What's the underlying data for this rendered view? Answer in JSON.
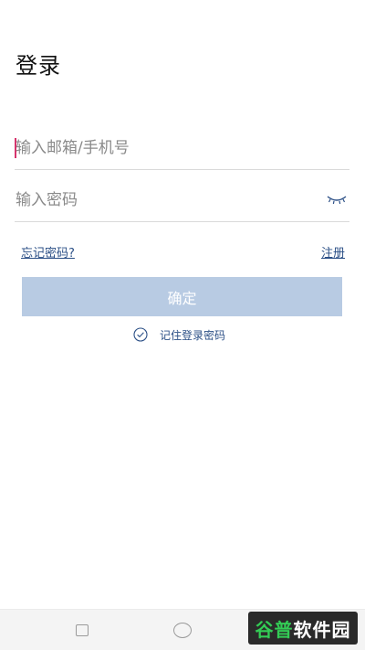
{
  "header": {
    "title": "登录"
  },
  "form": {
    "account_placeholder": "输入邮箱/手机号",
    "password_placeholder": "输入密码",
    "forgot_label": "忘记密码?",
    "register_label": "注册",
    "confirm_label": "确定",
    "remember_label": "记住登录密码"
  },
  "watermark": {
    "part1": "谷普",
    "part2": "软件园"
  },
  "colors": {
    "accent": "#2b4f86",
    "button_disabled": "#b8cbe3",
    "caret": "#d6336c"
  },
  "icons": [
    "eye-closed-icon",
    "check-circle-icon",
    "nav-recent-icon",
    "nav-home-icon"
  ]
}
